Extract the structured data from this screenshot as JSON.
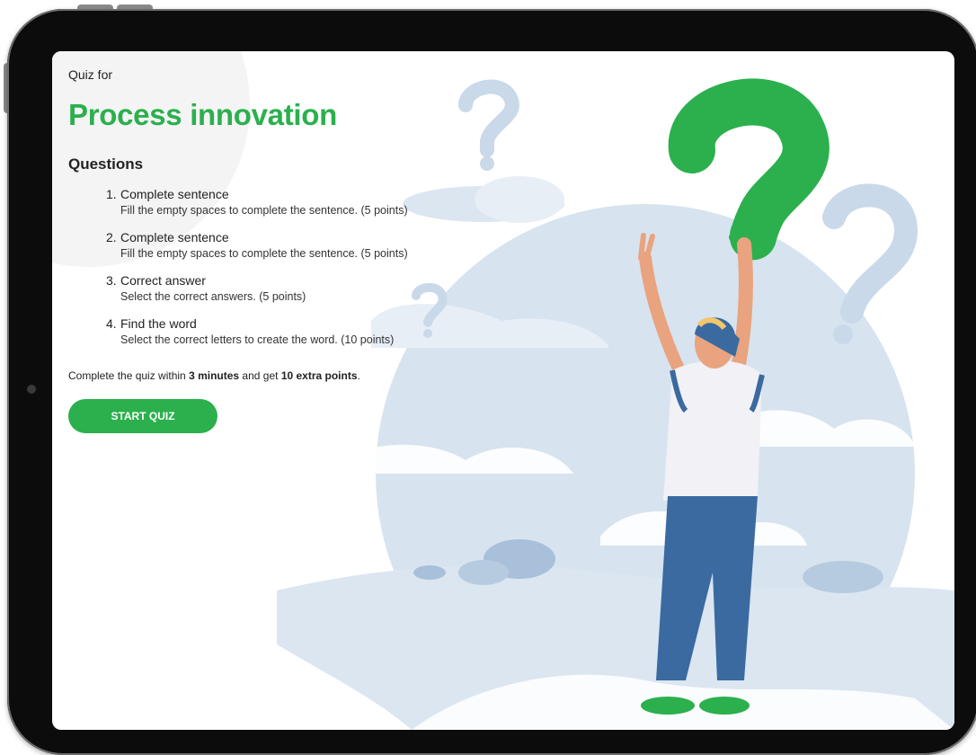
{
  "quiz": {
    "kicker": "Quiz for",
    "title": "Process innovation",
    "questions_heading": "Questions",
    "questions": [
      {
        "num": "1.",
        "title": "Complete sentence",
        "description": "Fill the empty spaces to complete the sentence. (5 points)"
      },
      {
        "num": "2.",
        "title": "Complete sentence",
        "description": "Fill the empty spaces to complete the sentence. (5 points)"
      },
      {
        "num": "3.",
        "title": "Correct answer",
        "description": "Select the correct answers. (5 points)"
      },
      {
        "num": "4.",
        "title": "Find the word",
        "description": "Select the correct letters to create the word. (10 points)"
      }
    ],
    "footer": {
      "prefix": "Complete the quiz within ",
      "time": "3 minutes",
      "middle": " and get ",
      "bonus": "10 extra points",
      "suffix": "."
    },
    "start_button": "START QUIZ"
  },
  "colors": {
    "accent": "#2bb04d",
    "illustration_light": "#dbe6f1",
    "illustration_mid": "#c3d4e7",
    "device_frame": "#0c0c0c"
  },
  "icons": [
    "question-mark-icon"
  ]
}
